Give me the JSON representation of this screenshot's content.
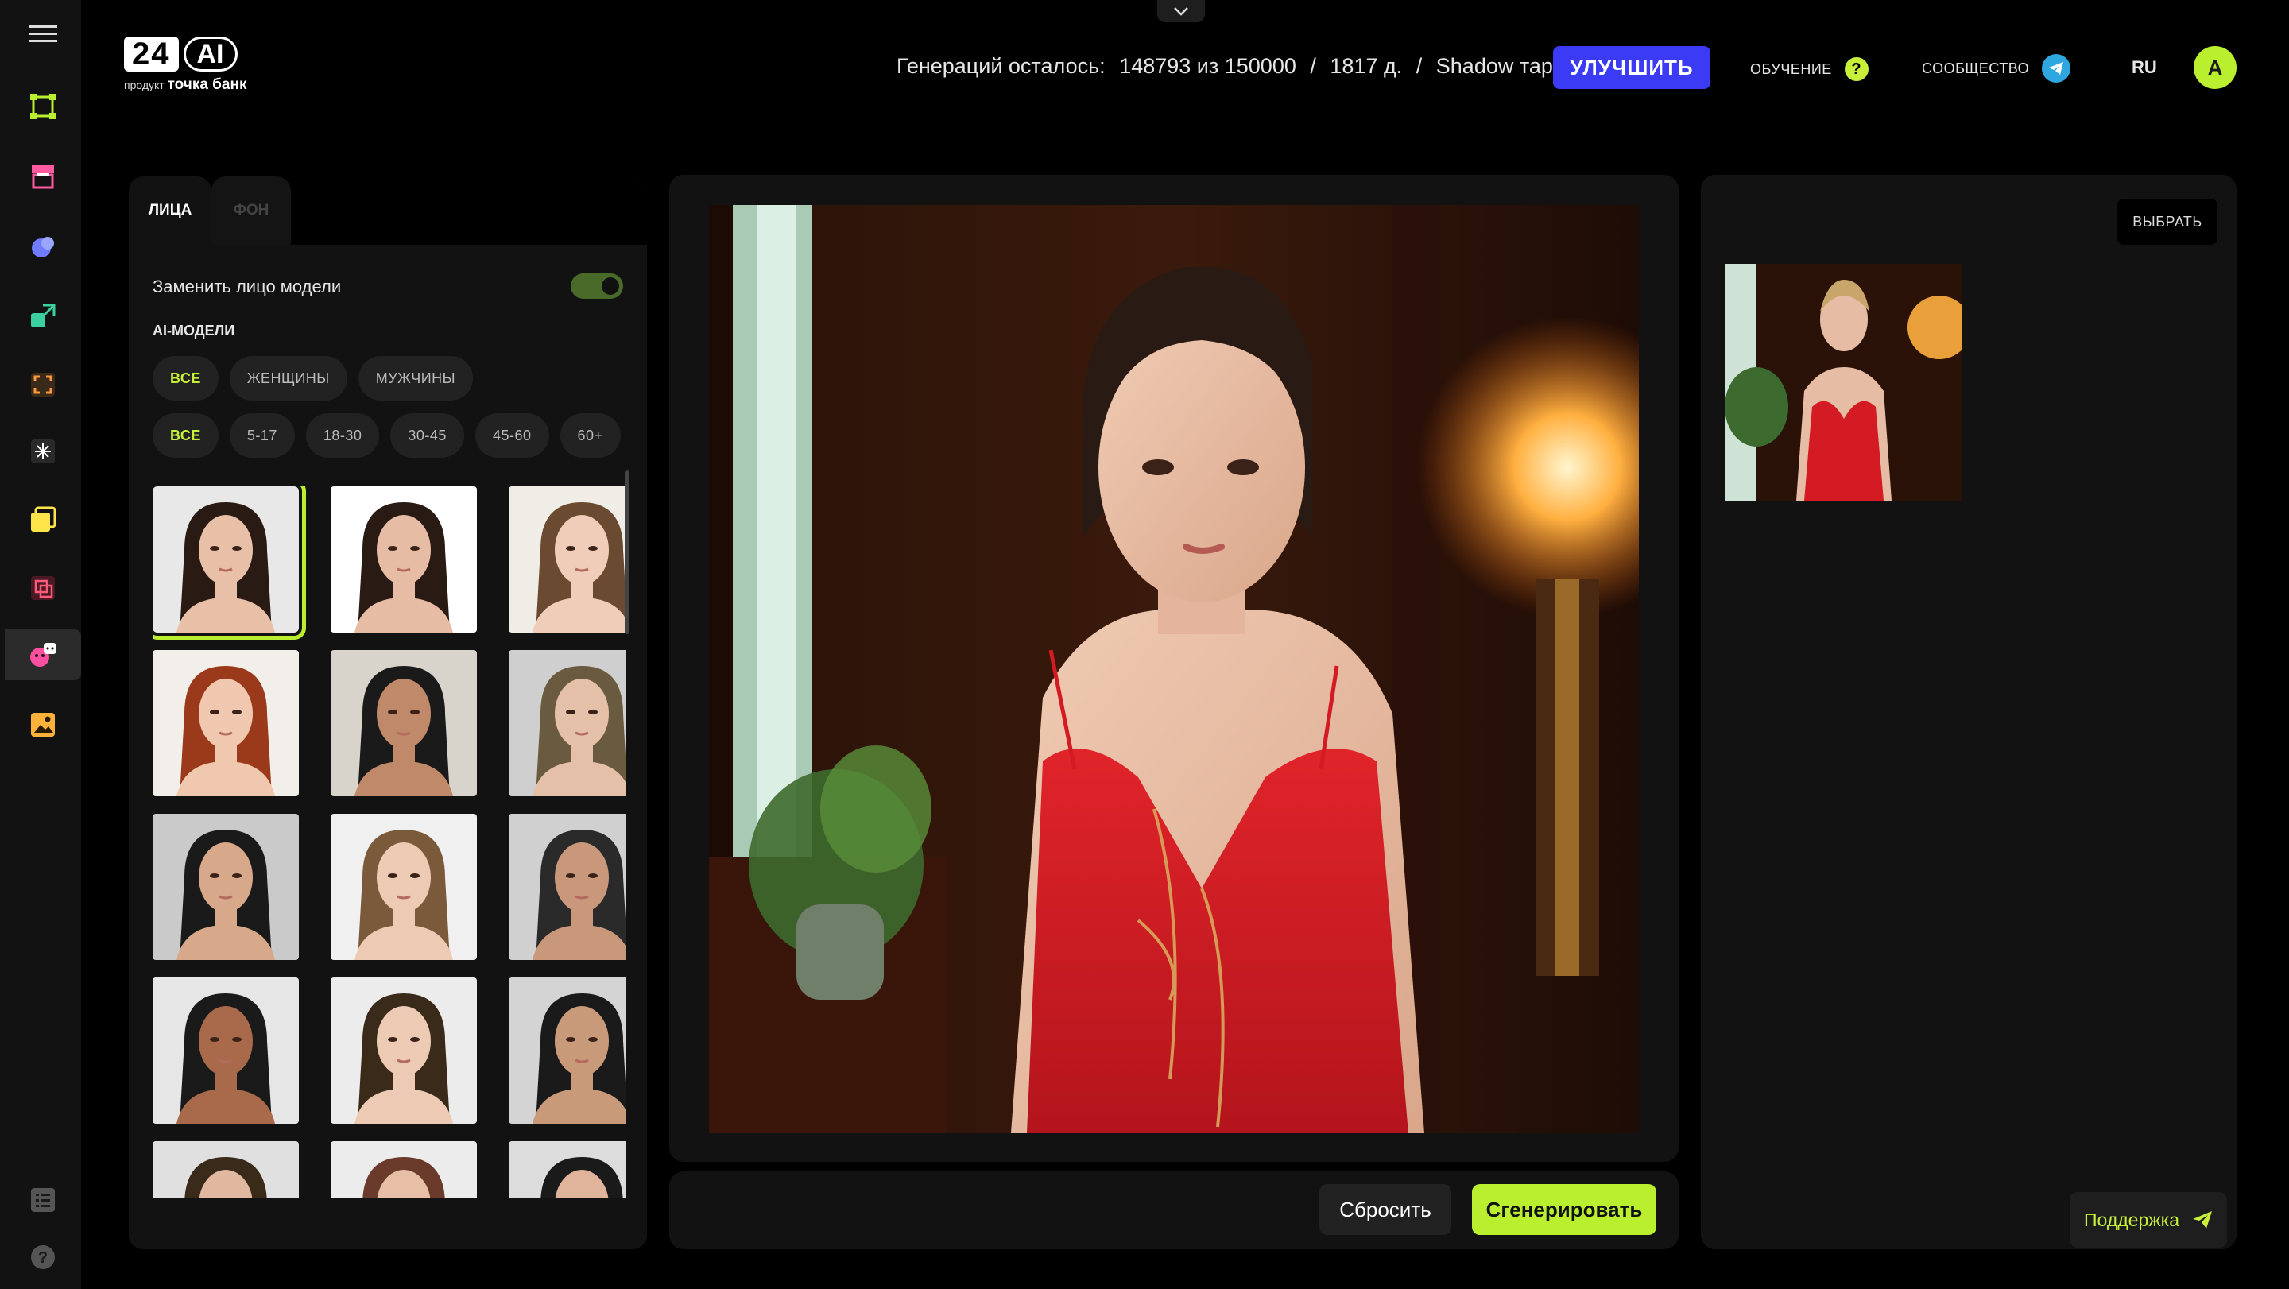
{
  "header": {
    "logo_number": "24",
    "logo_ai": "AI",
    "logo_prefix": "продукт",
    "logo_brand": "точка банк",
    "stats": {
      "label": "Генераций осталось:",
      "value": "148793 из 150000",
      "sep1": "/",
      "days": "1817 д.",
      "sep2": "/",
      "plan": "Shadow тариф"
    },
    "upgrade_label": "УЛУЧШИТЬ",
    "learning_label": "ОБУЧЕНИЕ",
    "learning_icon": "?",
    "community_label": "СООБЩЕСТВО",
    "language": "RU",
    "avatar_initial": "A"
  },
  "left_panel": {
    "tabs": [
      {
        "label": "ЛИЦА",
        "active": true
      },
      {
        "label": "ФОН",
        "active": false
      }
    ],
    "swap_face_label": "Заменить лицо модели",
    "swap_face_enabled": true,
    "ai_models_label": "AI-МОДЕЛИ",
    "gender_filters": [
      "ВСЕ",
      "ЖЕНЩИНЫ",
      "МУЖЧИНЫ"
    ],
    "age_filters": [
      "ВСЕ",
      "5-17",
      "18-30",
      "30-45",
      "45-60",
      "60+"
    ]
  },
  "actions": {
    "reset_label": "Сбросить",
    "generate_label": "Сгенерировать"
  },
  "right_panel": {
    "select_label": "ВЫБРАТЬ",
    "support_label": "Поддержка"
  },
  "colors": {
    "accent": "#b9ef2f",
    "primary_button": "#3b3bf5",
    "panel": "#121212",
    "background": "#000000"
  }
}
